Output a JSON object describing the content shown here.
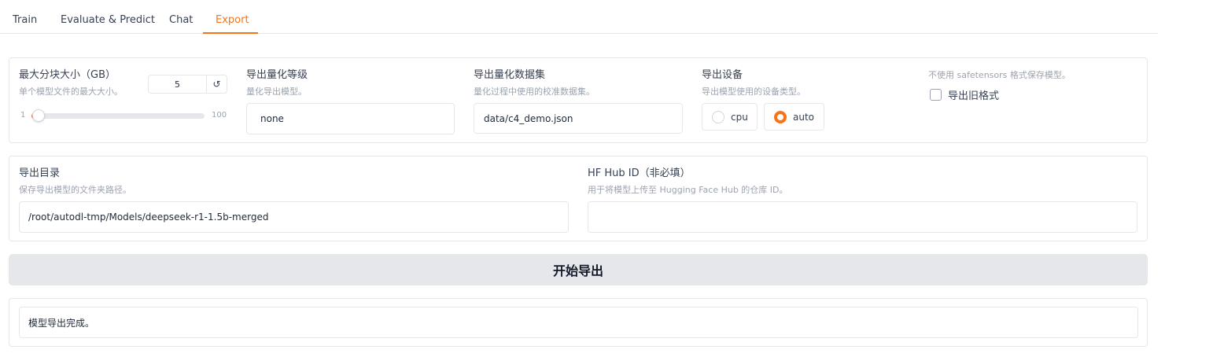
{
  "tabs": [
    {
      "label": "Train",
      "active": false
    },
    {
      "label": "Evaluate & Predict",
      "active": false
    },
    {
      "label": "Chat",
      "active": false
    },
    {
      "label": "Export",
      "active": true
    }
  ],
  "max_shard": {
    "label": "最大分块大小（GB）",
    "info": "单个模型文件的最大大小。",
    "value": "5",
    "reset_icon": "↺",
    "min": "1",
    "max": "100",
    "fraction": 0.04
  },
  "quant_bit": {
    "label": "导出量化等级",
    "info": "量化导出模型。",
    "value": "none"
  },
  "quant_dataset": {
    "label": "导出量化数据集",
    "info": "量化过程中使用的校准数据集。",
    "value": "data/c4_demo.json"
  },
  "device": {
    "label": "导出设备",
    "info": "导出模型使用的设备类型。",
    "options": [
      {
        "label": "cpu",
        "checked": false
      },
      {
        "label": "auto",
        "checked": true
      }
    ]
  },
  "legacy": {
    "info": "不使用 safetensors 格式保存模型。",
    "label": "导出旧格式",
    "checked": false
  },
  "export_dir": {
    "label": "导出目录",
    "info": "保存导出模型的文件夹路径。",
    "value": "/root/autodl-tmp/Models/deepseek-r1-1.5b-merged"
  },
  "hub_id": {
    "label": "HF Hub ID（非必填）",
    "info": "用于将模型上传至 Hugging Face Hub 的仓库 ID。",
    "value": ""
  },
  "export_button": {
    "label": "开始导出"
  },
  "output": {
    "value": "模型导出完成。"
  },
  "colors": {
    "accent": "#f97316",
    "button_bg": "#e5e7eb"
  }
}
